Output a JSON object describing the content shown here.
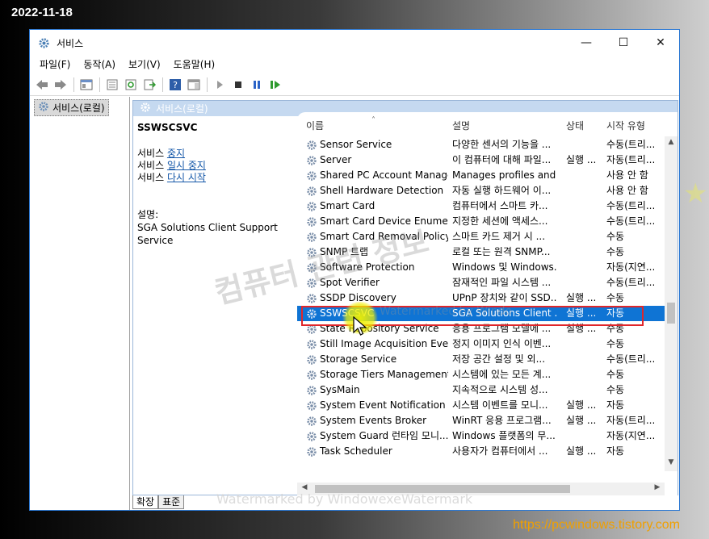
{
  "stamp": {
    "date": "2022-11-18",
    "site": "https://pcwindows.tistory.com"
  },
  "window": {
    "title": "서비스",
    "controls": {
      "minimize": "—",
      "maximize": "☐",
      "close": "✕"
    }
  },
  "menu": [
    "파일(F)",
    "동작(A)",
    "보기(V)",
    "도움말(H)"
  ],
  "tree": {
    "root": "서비스(로컬)"
  },
  "content_header": "서비스(로컬)",
  "detail": {
    "service_name": "SSWSCSVC",
    "actions": [
      {
        "prefix": "서비스 ",
        "link": "중지"
      },
      {
        "prefix": "서비스 ",
        "link": "일시 중지"
      },
      {
        "prefix": "서비스 ",
        "link": "다시 시작"
      }
    ],
    "desc_label": "설명:",
    "desc_text": "SGA Solutions Client Support Service"
  },
  "columns": {
    "name": "이름",
    "desc": "설명",
    "status": "상태",
    "start": "시작 유형"
  },
  "services": [
    {
      "name": "Sensor Service",
      "desc": "다양한 센서의 기능을 ...",
      "status": "",
      "start": "수동(트리..."
    },
    {
      "name": "Server",
      "desc": "이 컴퓨터에 대해 파일...",
      "status": "실행 ...",
      "start": "자동(트리..."
    },
    {
      "name": "Shared PC Account Manager",
      "desc": "Manages profiles and ...",
      "status": "",
      "start": "사용 안 함"
    },
    {
      "name": "Shell Hardware Detection",
      "desc": "자동 실행 하드웨어 이...",
      "status": "",
      "start": "사용 안 함"
    },
    {
      "name": "Smart Card",
      "desc": "컴퓨터에서 스마트 카...",
      "status": "",
      "start": "수동(트리..."
    },
    {
      "name": "Smart Card Device Enumer...",
      "desc": "지정한 세션에 액세스...",
      "status": "",
      "start": "수동(트리..."
    },
    {
      "name": "Smart Card Removal Policy",
      "desc": "스마트 카드 제거 시 ...",
      "status": "",
      "start": "수동"
    },
    {
      "name": "SNMP 트랩",
      "desc": "로컬 또는 원격 SNMP...",
      "status": "",
      "start": "수동"
    },
    {
      "name": "Software Protection",
      "desc": "Windows 및 Windows...",
      "status": "",
      "start": "자동(지연..."
    },
    {
      "name": "Spot Verifier",
      "desc": "잠재적인 파일 시스템 ...",
      "status": "",
      "start": "수동(트리..."
    },
    {
      "name": "SSDP Discovery",
      "desc": "UPnP 장치와 같이 SSD...",
      "status": "실행 ...",
      "start": "수동"
    },
    {
      "name": "SSWSCSVC",
      "desc": "SGA Solutions Client ...",
      "status": "실행 ...",
      "start": "자동",
      "selected": true
    },
    {
      "name": "State Repository Service",
      "desc": "응용 프로그램 모델에 ...",
      "status": "실행 ...",
      "start": "수동"
    },
    {
      "name": "Still Image Acquisition Eve...",
      "desc": "정지 이미지 인식 이벤...",
      "status": "",
      "start": "수동"
    },
    {
      "name": "Storage Service",
      "desc": "저장 공간 설정 및 외...",
      "status": "",
      "start": "수동(트리..."
    },
    {
      "name": "Storage Tiers Management",
      "desc": "시스템에 있는 모든 계...",
      "status": "",
      "start": "수동"
    },
    {
      "name": "SysMain",
      "desc": "지속적으로 시스템 성...",
      "status": "",
      "start": "수동"
    },
    {
      "name": "System Event Notification ...",
      "desc": "시스템 이벤트를 모니...",
      "status": "실행 ...",
      "start": "자동"
    },
    {
      "name": "System Events Broker",
      "desc": "WinRT 응용 프로그램...",
      "status": "실행 ...",
      "start": "자동(트리..."
    },
    {
      "name": "System Guard 런타임 모니...",
      "desc": "Windows 플랫폼의 무...",
      "status": "",
      "start": "자동(지연..."
    },
    {
      "name": "Task Scheduler",
      "desc": "사용자가 컴퓨터에서 ...",
      "status": "실행 ...",
      "start": "자동"
    }
  ],
  "tabs": [
    "확장",
    "표준"
  ],
  "watermarks": {
    "big": "컴퓨터 관련 정보",
    "small": "Watermarked by WindowexeWatermark",
    "row": "Watermarked by Windo"
  },
  "accent": "#0f74d4",
  "highlight_color": "#e0262a"
}
